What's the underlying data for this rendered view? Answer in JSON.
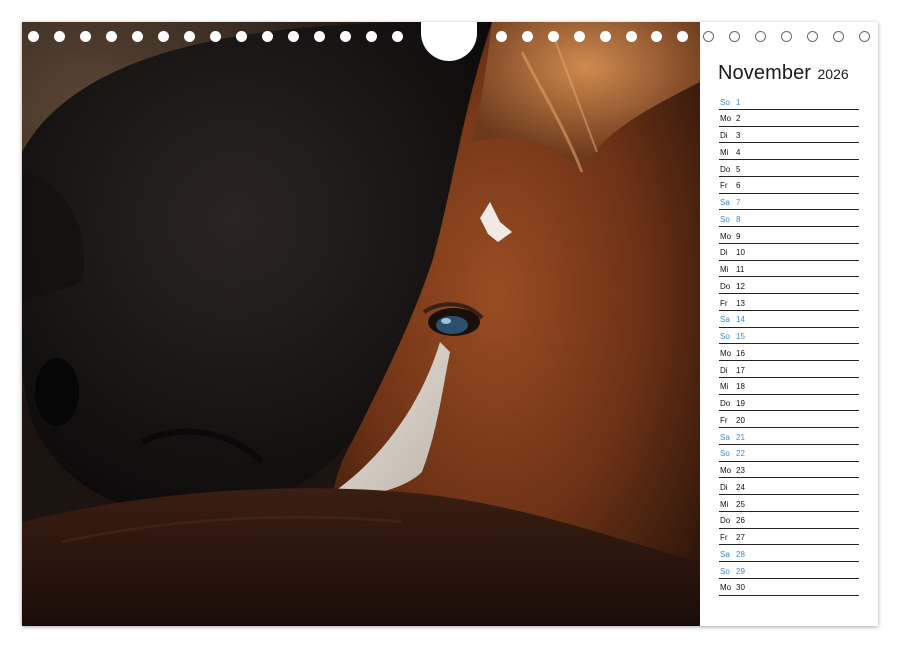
{
  "calendar": {
    "month": "November",
    "year": "2026",
    "accent_color": "#3a8fc6",
    "photo": {
      "subject": "horse-portrait"
    },
    "days": [
      {
        "dn": "So",
        "d": "1",
        "weekend": true
      },
      {
        "dn": "Mo",
        "d": "2",
        "weekend": false
      },
      {
        "dn": "Di",
        "d": "3",
        "weekend": false
      },
      {
        "dn": "Mi",
        "d": "4",
        "weekend": false
      },
      {
        "dn": "Do",
        "d": "5",
        "weekend": false
      },
      {
        "dn": "Fr",
        "d": "6",
        "weekend": false
      },
      {
        "dn": "Sa",
        "d": "7",
        "weekend": true
      },
      {
        "dn": "So",
        "d": "8",
        "weekend": true
      },
      {
        "dn": "Mo",
        "d": "9",
        "weekend": false
      },
      {
        "dn": "Di",
        "d": "10",
        "weekend": false
      },
      {
        "dn": "Mi",
        "d": "11",
        "weekend": false
      },
      {
        "dn": "Do",
        "d": "12",
        "weekend": false
      },
      {
        "dn": "Fr",
        "d": "13",
        "weekend": false
      },
      {
        "dn": "Sa",
        "d": "14",
        "weekend": true
      },
      {
        "dn": "So",
        "d": "15",
        "weekend": true
      },
      {
        "dn": "Mo",
        "d": "16",
        "weekend": false
      },
      {
        "dn": "Di",
        "d": "17",
        "weekend": false
      },
      {
        "dn": "Mi",
        "d": "18",
        "weekend": false
      },
      {
        "dn": "Do",
        "d": "19",
        "weekend": false
      },
      {
        "dn": "Fr",
        "d": "20",
        "weekend": false
      },
      {
        "dn": "Sa",
        "d": "21",
        "weekend": true
      },
      {
        "dn": "So",
        "d": "22",
        "weekend": true
      },
      {
        "dn": "Mo",
        "d": "23",
        "weekend": false
      },
      {
        "dn": "Di",
        "d": "24",
        "weekend": false
      },
      {
        "dn": "Mi",
        "d": "25",
        "weekend": false
      },
      {
        "dn": "Do",
        "d": "26",
        "weekend": false
      },
      {
        "dn": "Fr",
        "d": "27",
        "weekend": false
      },
      {
        "dn": "Sa",
        "d": "28",
        "weekend": true
      },
      {
        "dn": "So",
        "d": "29",
        "weekend": true
      },
      {
        "dn": "Mo",
        "d": "30",
        "weekend": false
      }
    ]
  }
}
